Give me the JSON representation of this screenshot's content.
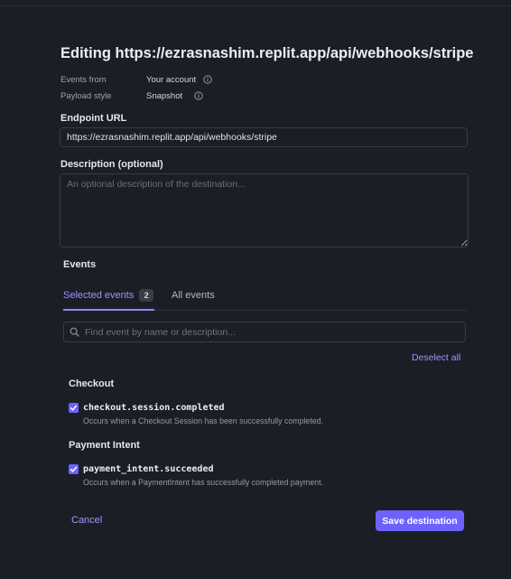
{
  "header": {
    "title": "Editing https://ezrasnashim.replit.app/api/webhooks/stripe"
  },
  "meta": {
    "events_from_label": "Events from",
    "events_from_value": "Your account",
    "payload_style_label": "Payload style",
    "payload_style_value": "Snapshot"
  },
  "endpoint": {
    "label": "Endpoint URL",
    "value": "https://ezrasnashim.replit.app/api/webhooks/stripe"
  },
  "description": {
    "label": "Description (optional)",
    "placeholder": "An optional description of the destination..."
  },
  "events": {
    "label": "Events",
    "tabs": [
      {
        "label": "Selected events",
        "count": "2",
        "active": true
      },
      {
        "label": "All events",
        "active": false
      }
    ],
    "search_placeholder": "Find event by name or description...",
    "deselect_all": "Deselect all",
    "groups": [
      {
        "title": "Checkout",
        "items": [
          {
            "name": "checkout.session.completed",
            "description": "Occurs when a Checkout Session has been successfully completed.",
            "checked": true
          }
        ]
      },
      {
        "title": "Payment Intent",
        "items": [
          {
            "name": "payment_intent.succeeded",
            "description": "Occurs when a PaymentIntent has successfully completed payment.",
            "checked": true
          }
        ]
      }
    ]
  },
  "footer": {
    "cancel_label": "Cancel",
    "save_label": "Save destination"
  },
  "colors": {
    "background": "#1c1e26",
    "accent": "#6c63ff",
    "link": "#9c96ff"
  },
  "icons": {
    "info": "info-circle-icon",
    "search": "search-icon",
    "check": "checkmark-icon"
  }
}
